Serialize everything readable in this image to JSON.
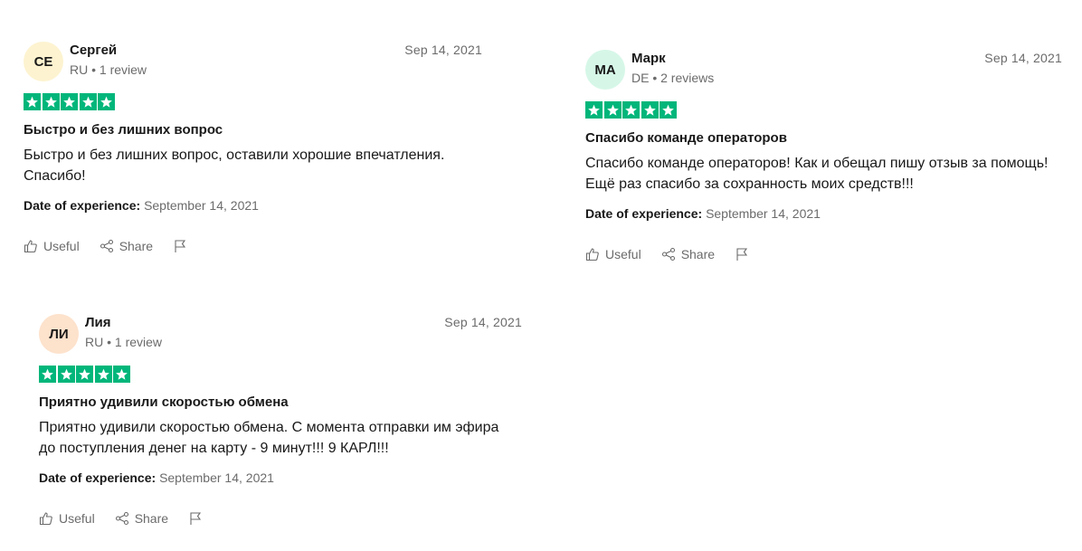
{
  "colors": {
    "star_green": "#00b67a",
    "text": "#191919",
    "muted": "#6b6b6b"
  },
  "labels": {
    "date_of_experience": "Date of experience:",
    "useful": "Useful",
    "share": "Share"
  },
  "icons": {
    "useful": "thumbs-up-icon",
    "share": "share-icon",
    "report": "flag-icon",
    "star": "star-icon"
  },
  "reviews": [
    {
      "initials": "CE",
      "avatar_color": "#fdf3d0",
      "name": "Сергей",
      "meta": "RU • 1 review",
      "date": "Sep 14, 2021",
      "rating": 5,
      "title": "Быстро и без лишних вопрос",
      "body_lines": [
        "Быстро и без лишних вопрос, оставили хорошие впечатления.",
        "Спасибо!"
      ],
      "experience_date": "September 14, 2021"
    },
    {
      "initials": "MA",
      "avatar_color": "#d6f7e8",
      "name": "Марк",
      "meta": "DE • 2 reviews",
      "date": "Sep 14, 2021",
      "rating": 5,
      "title": "Спасибо команде операторов",
      "body_lines": [
        "Спасибо команде операторов! Как и обещал пишу отзыв за помощь!",
        "Ещё раз спасибо за сохранность моих средств!!!"
      ],
      "experience_date": "September 14, 2021"
    },
    {
      "initials": "ЛИ",
      "avatar_color": "#fde2cc",
      "name": "Лия",
      "meta": "RU • 1 review",
      "date": "Sep 14, 2021",
      "rating": 5,
      "title": "Приятно удивили скоростью обмена",
      "body_lines": [
        "Приятно удивили скоростью обмена. С момента отправки им эфира",
        "до поступления денег на карту - 9 минут!!! 9 КАРЛ!!!"
      ],
      "experience_date": "September 14, 2021"
    }
  ]
}
